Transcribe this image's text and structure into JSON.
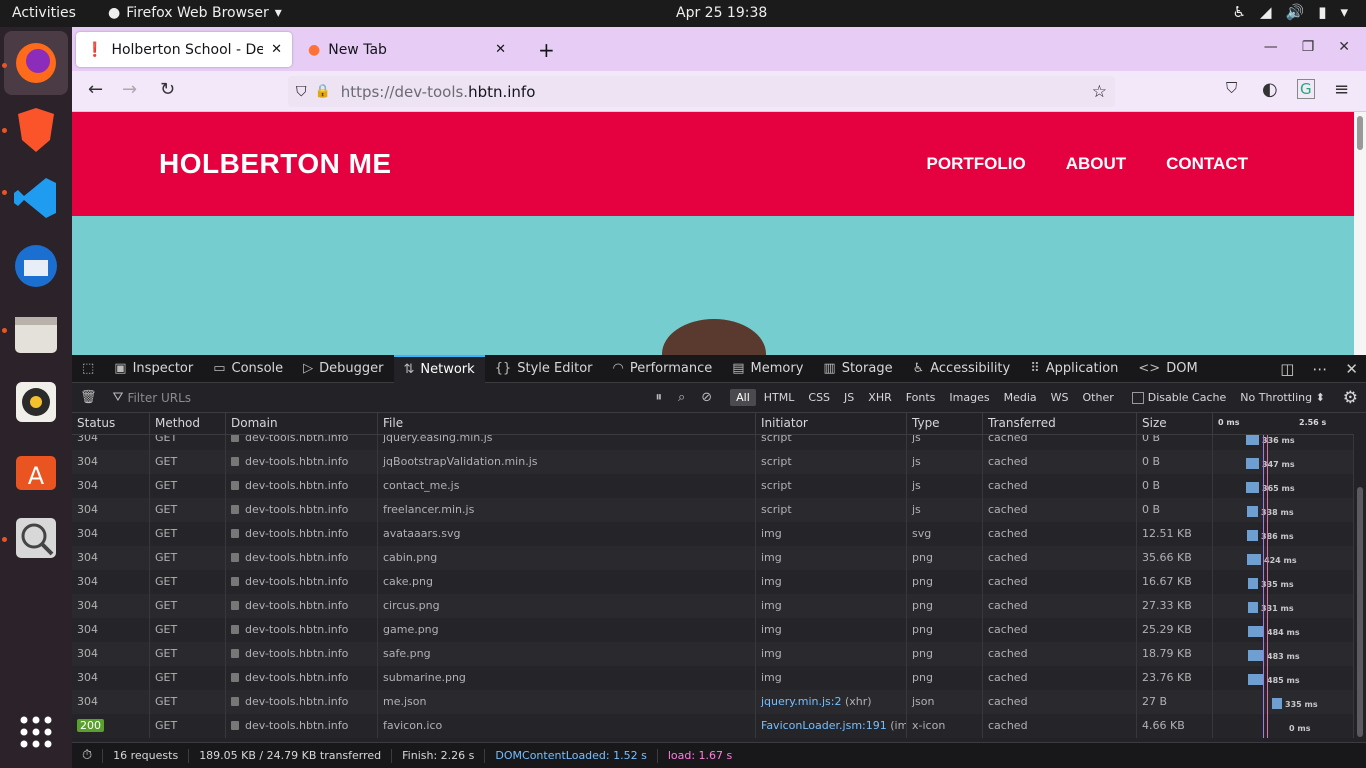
{
  "topbar": {
    "activities": "Activities",
    "app_name": "Firefox Web Browser",
    "clock": "Apr 25  19:38"
  },
  "browser": {
    "tabs": [
      {
        "title": "Holberton School - Devel"
      },
      {
        "title": "New Tab"
      }
    ],
    "url_prefix": "https://dev-tools.",
    "url_host": "hbtn.info"
  },
  "page": {
    "brand": "HOLBERTON ME",
    "nav": [
      "PORTFOLIO",
      "ABOUT",
      "CONTACT"
    ]
  },
  "devtools": {
    "tabs": [
      "Inspector",
      "Console",
      "Debugger",
      "Network",
      "Style Editor",
      "Performance",
      "Memory",
      "Storage",
      "Accessibility",
      "Application",
      "DOM"
    ],
    "selected_tab": "Network",
    "filter_placeholder": "Filter URLs",
    "filter_types": [
      "All",
      "HTML",
      "CSS",
      "JS",
      "XHR",
      "Fonts",
      "Images",
      "Media",
      "WS",
      "Other"
    ],
    "disable_cache": "Disable Cache",
    "throttling": "No Throttling ⬍",
    "columns": [
      "Status",
      "Method",
      "Domain",
      "File",
      "Initiator",
      "Type",
      "Transferred",
      "Size"
    ],
    "waterfall_ticks": [
      "0 ms",
      "2.56 s"
    ],
    "rows": [
      {
        "status": "304",
        "method": "GET",
        "domain": "dev-tools.hbtn.info",
        "file": "jquery.easing.min.js",
        "initiator": "script",
        "type": "js",
        "transferred": "cached",
        "size": "0 B",
        "time": "336 ms",
        "start": 0.235,
        "dur": 0.09
      },
      {
        "status": "304",
        "method": "GET",
        "domain": "dev-tools.hbtn.info",
        "file": "jqBootstrapValidation.min.js",
        "initiator": "script",
        "type": "js",
        "transferred": "cached",
        "size": "0 B",
        "time": "347 ms",
        "start": 0.235,
        "dur": 0.09
      },
      {
        "status": "304",
        "method": "GET",
        "domain": "dev-tools.hbtn.info",
        "file": "contact_me.js",
        "initiator": "script",
        "type": "js",
        "transferred": "cached",
        "size": "0 B",
        "time": "365 ms",
        "start": 0.235,
        "dur": 0.09
      },
      {
        "status": "304",
        "method": "GET",
        "domain": "dev-tools.hbtn.info",
        "file": "freelancer.min.js",
        "initiator": "script",
        "type": "js",
        "transferred": "cached",
        "size": "0 B",
        "time": "338 ms",
        "start": 0.24,
        "dur": 0.08
      },
      {
        "status": "304",
        "method": "GET",
        "domain": "dev-tools.hbtn.info",
        "file": "avataaars.svg",
        "initiator": "img",
        "type": "svg",
        "transferred": "cached",
        "size": "12.51 KB",
        "time": "386 ms",
        "start": 0.24,
        "dur": 0.08
      },
      {
        "status": "304",
        "method": "GET",
        "domain": "dev-tools.hbtn.info",
        "file": "cabin.png",
        "initiator": "img",
        "type": "png",
        "transferred": "cached",
        "size": "35.66 KB",
        "time": "424 ms",
        "start": 0.24,
        "dur": 0.1
      },
      {
        "status": "304",
        "method": "GET",
        "domain": "dev-tools.hbtn.info",
        "file": "cake.png",
        "initiator": "img",
        "type": "png",
        "transferred": "cached",
        "size": "16.67 KB",
        "time": "335 ms",
        "start": 0.245,
        "dur": 0.07
      },
      {
        "status": "304",
        "method": "GET",
        "domain": "dev-tools.hbtn.info",
        "file": "circus.png",
        "initiator": "img",
        "type": "png",
        "transferred": "cached",
        "size": "27.33 KB",
        "time": "331 ms",
        "start": 0.25,
        "dur": 0.06
      },
      {
        "status": "304",
        "method": "GET",
        "domain": "dev-tools.hbtn.info",
        "file": "game.png",
        "initiator": "img",
        "type": "png",
        "transferred": "cached",
        "size": "25.29 KB",
        "time": "484 ms",
        "start": 0.25,
        "dur": 0.11
      },
      {
        "status": "304",
        "method": "GET",
        "domain": "dev-tools.hbtn.info",
        "file": "safe.png",
        "initiator": "img",
        "type": "png",
        "transferred": "cached",
        "size": "18.79 KB",
        "time": "483 ms",
        "start": 0.25,
        "dur": 0.11
      },
      {
        "status": "304",
        "method": "GET",
        "domain": "dev-tools.hbtn.info",
        "file": "submarine.png",
        "initiator": "img",
        "type": "png",
        "transferred": "cached",
        "size": "23.76 KB",
        "time": "485 ms",
        "start": 0.25,
        "dur": 0.11
      },
      {
        "status": "304",
        "method": "GET",
        "domain": "dev-tools.hbtn.info",
        "file": "me.json",
        "initiator": "jquery.min.js:2",
        "initiator_suffix": " (xhr)",
        "type": "json",
        "transferred": "cached",
        "size": "27 B",
        "time": "335 ms",
        "start": 0.42,
        "dur": 0.07
      },
      {
        "status": "200",
        "method": "GET",
        "domain": "dev-tools.hbtn.info",
        "file": "favicon.ico",
        "initiator": "FaviconLoader.jsm:191",
        "initiator_suffix": " (img)",
        "type": "x-icon",
        "transferred": "cached",
        "size": "4.66 KB",
        "time": "0 ms",
        "start": 0.52,
        "dur": 0
      }
    ],
    "status": {
      "requests": "16 requests",
      "size": "189.05 KB / 24.79 KB transferred",
      "finish": "Finish: 2.26 s",
      "dcl": "DOMContentLoaded: 1.52 s",
      "load": "load: 1.67 s"
    },
    "colors": {
      "dcl": "#75bfff",
      "load": "#ff7de0",
      "accent": "#3cb4ff"
    }
  }
}
